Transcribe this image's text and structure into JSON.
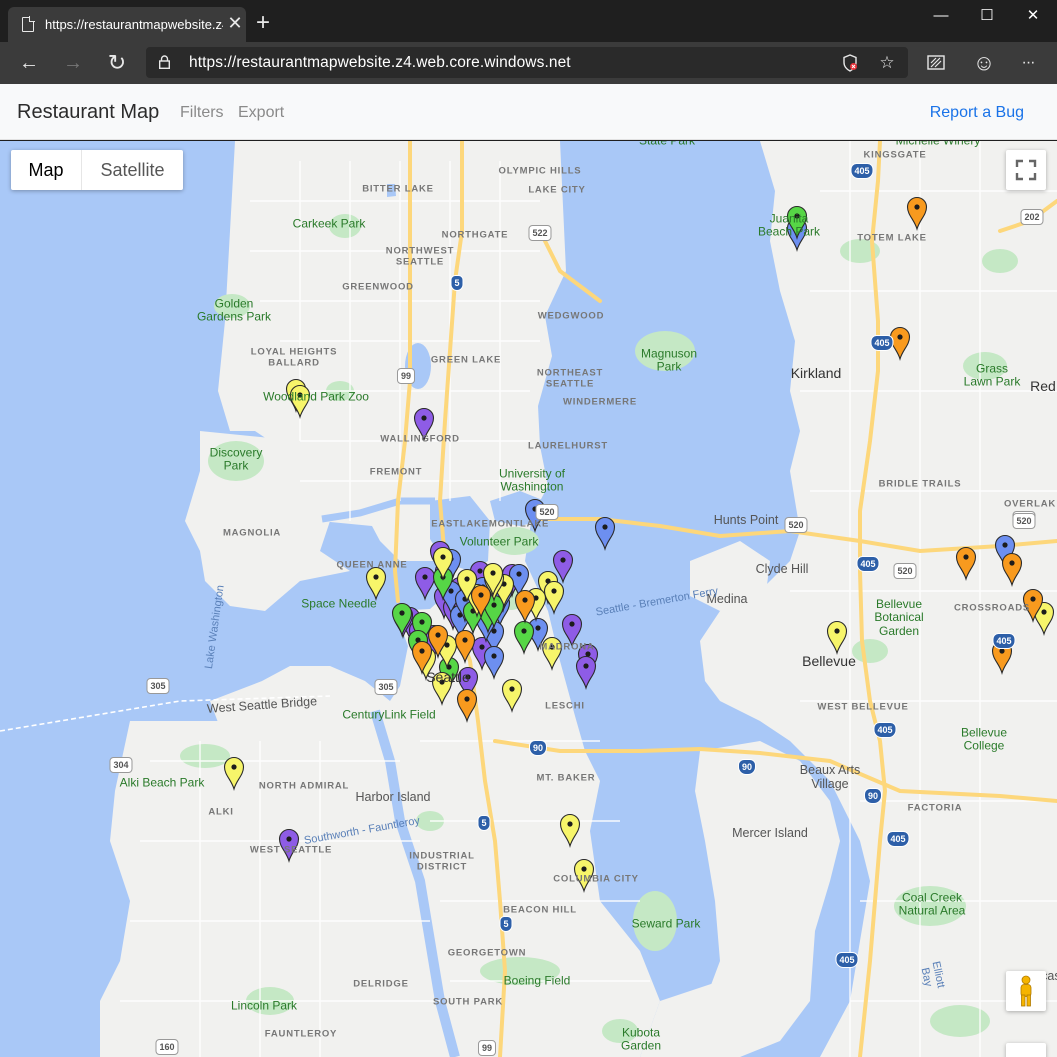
{
  "browser": {
    "tab_title": "https://restaurantmapwebsite.z4",
    "tab_close_label": "✕",
    "new_tab_label": "+",
    "url": "https://restaurantmapwebsite.z4.web.core.windows.net",
    "back_label": "←",
    "forward_label": "→",
    "refresh_label": "↻",
    "window_controls": {
      "minimize": "—",
      "maximize": "☐",
      "close": "✕"
    },
    "toolbar_icons": [
      "tracking-prevention-icon",
      "favorite-star-icon",
      "collections-icon",
      "feedback-smiley-icon",
      "more-menu-icon"
    ],
    "toolbar_glyphs": {
      "favorite": "☆",
      "feedback": "☺",
      "more": "···"
    }
  },
  "app": {
    "brand": "Restaurant Map",
    "nav": [
      "Filters",
      "Export"
    ],
    "report_bug": "Report a Bug"
  },
  "map": {
    "map_type_options": [
      "Map",
      "Satellite"
    ],
    "selected_map_type": "Map",
    "colors": {
      "water": "#a9c8f7",
      "land": "#f1f1ef",
      "park": "#c5e8c5",
      "highway": "#fdd77b",
      "pin_purple": "#8e5ce6",
      "pin_blue": "#6d8ff0",
      "pin_green": "#56d646",
      "pin_yellow": "#f7f56a",
      "pin_orange": "#f89a1e"
    },
    "labels": [
      {
        "text": "OLYMPIC HILLS",
        "kind": "hood"
      },
      {
        "text": "BITTER LAKE",
        "kind": "hood"
      },
      {
        "text": "LAKE CITY",
        "kind": "hood"
      },
      {
        "text": "NORTHGATE",
        "kind": "hood"
      },
      {
        "text": "NORTHWEST\nSEATTLE",
        "kind": "hood"
      },
      {
        "text": "GREENWOOD",
        "kind": "hood"
      },
      {
        "text": "WEDGWOOD",
        "kind": "hood"
      },
      {
        "text": "LOYAL HEIGHTS\nBALLARD",
        "kind": "hood"
      },
      {
        "text": "GREEN LAKE",
        "kind": "hood"
      },
      {
        "text": "NORTHEAST\nSEATTLE",
        "kind": "hood"
      },
      {
        "text": "WINDERMERE",
        "kind": "hood"
      },
      {
        "text": "WALLINGFORD",
        "kind": "hood"
      },
      {
        "text": "LAURELHURST",
        "kind": "hood"
      },
      {
        "text": "FREMONT",
        "kind": "hood"
      },
      {
        "text": "MAGNOLIA",
        "kind": "hood"
      },
      {
        "text": "EASTLAKE",
        "kind": "hood"
      },
      {
        "text": "QUEEN ANNE",
        "kind": "hood"
      },
      {
        "text": "LESCHI",
        "kind": "hood"
      },
      {
        "text": "MT. BAKER",
        "kind": "hood"
      },
      {
        "text": "NORTH ADMIRAL",
        "kind": "hood"
      },
      {
        "text": "ALKI",
        "kind": "hood"
      },
      {
        "text": "WEST SEATTLE",
        "kind": "hood"
      },
      {
        "text": "INDUSTRIAL\nDISTRICT",
        "kind": "hood"
      },
      {
        "text": "COLUMBIA CITY",
        "kind": "hood"
      },
      {
        "text": "BEACON HILL",
        "kind": "hood"
      },
      {
        "text": "GEORGETOWN",
        "kind": "hood"
      },
      {
        "text": "DELRIDGE",
        "kind": "hood"
      },
      {
        "text": "SOUTH PARK",
        "kind": "hood"
      },
      {
        "text": "FAUNTLEROY",
        "kind": "hood"
      },
      {
        "text": "KINGSGATE",
        "kind": "hood"
      },
      {
        "text": "TOTEM LAKE",
        "kind": "hood"
      },
      {
        "text": "BRIDLE TRAILS",
        "kind": "hood"
      },
      {
        "text": "OVERLAK",
        "kind": "hood"
      },
      {
        "text": "CROSSROADS",
        "kind": "hood"
      },
      {
        "text": "WEST BELLEVUE",
        "kind": "hood"
      },
      {
        "text": "FACTORIA",
        "kind": "hood"
      },
      {
        "text": "MONTLAKE",
        "kind": "hood"
      },
      {
        "text": "MADRONA",
        "kind": "hood"
      },
      {
        "text": "Carkeek Park",
        "kind": "place"
      },
      {
        "text": "Golden\nGardens Park",
        "kind": "place"
      },
      {
        "text": "Woodland Park Zoo",
        "kind": "place"
      },
      {
        "text": "Discovery\nPark",
        "kind": "place"
      },
      {
        "text": "Magnuson\nPark",
        "kind": "place"
      },
      {
        "text": "University of\nWashington",
        "kind": "place"
      },
      {
        "text": "Volunteer Park",
        "kind": "place"
      },
      {
        "text": "Space Needle",
        "kind": "place"
      },
      {
        "text": "CenturyLink Field",
        "kind": "place"
      },
      {
        "text": "Alki Beach Park",
        "kind": "place"
      },
      {
        "text": "Seward Park",
        "kind": "place"
      },
      {
        "text": "Boeing Field",
        "kind": "place"
      },
      {
        "text": "Lincoln Park",
        "kind": "place"
      },
      {
        "text": "Kubota\nGarden",
        "kind": "place"
      },
      {
        "text": "Juanita\nBeach Park",
        "kind": "place"
      },
      {
        "text": "Grass\nLawn Park",
        "kind": "place"
      },
      {
        "text": "Bellevue\nBotanical\nGarden",
        "kind": "place"
      },
      {
        "text": "Bellevue\nCollege",
        "kind": "place"
      },
      {
        "text": "Coal Creek\nNatural Area",
        "kind": "place"
      },
      {
        "text": "Michelle Winery",
        "kind": "place"
      },
      {
        "text": "State Park",
        "kind": "place"
      },
      {
        "text": "Kirkland",
        "kind": "city"
      },
      {
        "text": "Bellevue",
        "kind": "city"
      },
      {
        "text": "Seattle",
        "kind": "city"
      },
      {
        "text": "Red",
        "kind": "city"
      },
      {
        "text": "Hunts Point",
        "kind": "area"
      },
      {
        "text": "Clyde Hill",
        "kind": "area"
      },
      {
        "text": "Medina",
        "kind": "area"
      },
      {
        "text": "Beaux Arts\nVillage",
        "kind": "area"
      },
      {
        "text": "Mercer Island",
        "kind": "area"
      },
      {
        "text": "Harbor Island",
        "kind": "area"
      },
      {
        "text": "Newcastle",
        "kind": "area"
      },
      {
        "text": "Elliott\nBay",
        "kind": "water"
      },
      {
        "text": "Lake Washington",
        "kind": "water"
      },
      {
        "text": "Seattle - Bremerton Ferry",
        "kind": "water"
      },
      {
        "text": "West Seattle Bridge",
        "kind": "area"
      },
      {
        "text": "Southworth - Fauntleroy",
        "kind": "water"
      }
    ],
    "shields": [
      {
        "text": "522",
        "kind": "state"
      },
      {
        "text": "5",
        "kind": "interstate"
      },
      {
        "text": "99",
        "kind": "state"
      },
      {
        "text": "520",
        "kind": "state"
      },
      {
        "text": "520",
        "kind": "state"
      },
      {
        "text": "520",
        "kind": "state"
      },
      {
        "text": "520",
        "kind": "state"
      },
      {
        "text": "520",
        "kind": "state"
      },
      {
        "text": "405",
        "kind": "interstate"
      },
      {
        "text": "405",
        "kind": "interstate"
      },
      {
        "text": "405",
        "kind": "interstate"
      },
      {
        "text": "405",
        "kind": "interstate"
      },
      {
        "text": "405",
        "kind": "interstate"
      },
      {
        "text": "405",
        "kind": "interstate"
      },
      {
        "text": "405",
        "kind": "interstate"
      },
      {
        "text": "202",
        "kind": "state"
      },
      {
        "text": "305",
        "kind": "state"
      },
      {
        "text": "305",
        "kind": "state"
      },
      {
        "text": "304",
        "kind": "state"
      },
      {
        "text": "90",
        "kind": "interstate"
      },
      {
        "text": "90",
        "kind": "interstate"
      },
      {
        "text": "90",
        "kind": "interstate"
      },
      {
        "text": "5",
        "kind": "interstate"
      },
      {
        "text": "5",
        "kind": "interstate"
      },
      {
        "text": "99",
        "kind": "state"
      },
      {
        "text": "160",
        "kind": "state"
      }
    ],
    "pins": [
      {
        "color": "purple",
        "count": 22
      },
      {
        "color": "blue",
        "count": 17
      },
      {
        "color": "green",
        "count": 11
      },
      {
        "color": "yellow",
        "count": 22
      },
      {
        "color": "orange",
        "count": 12
      }
    ]
  }
}
